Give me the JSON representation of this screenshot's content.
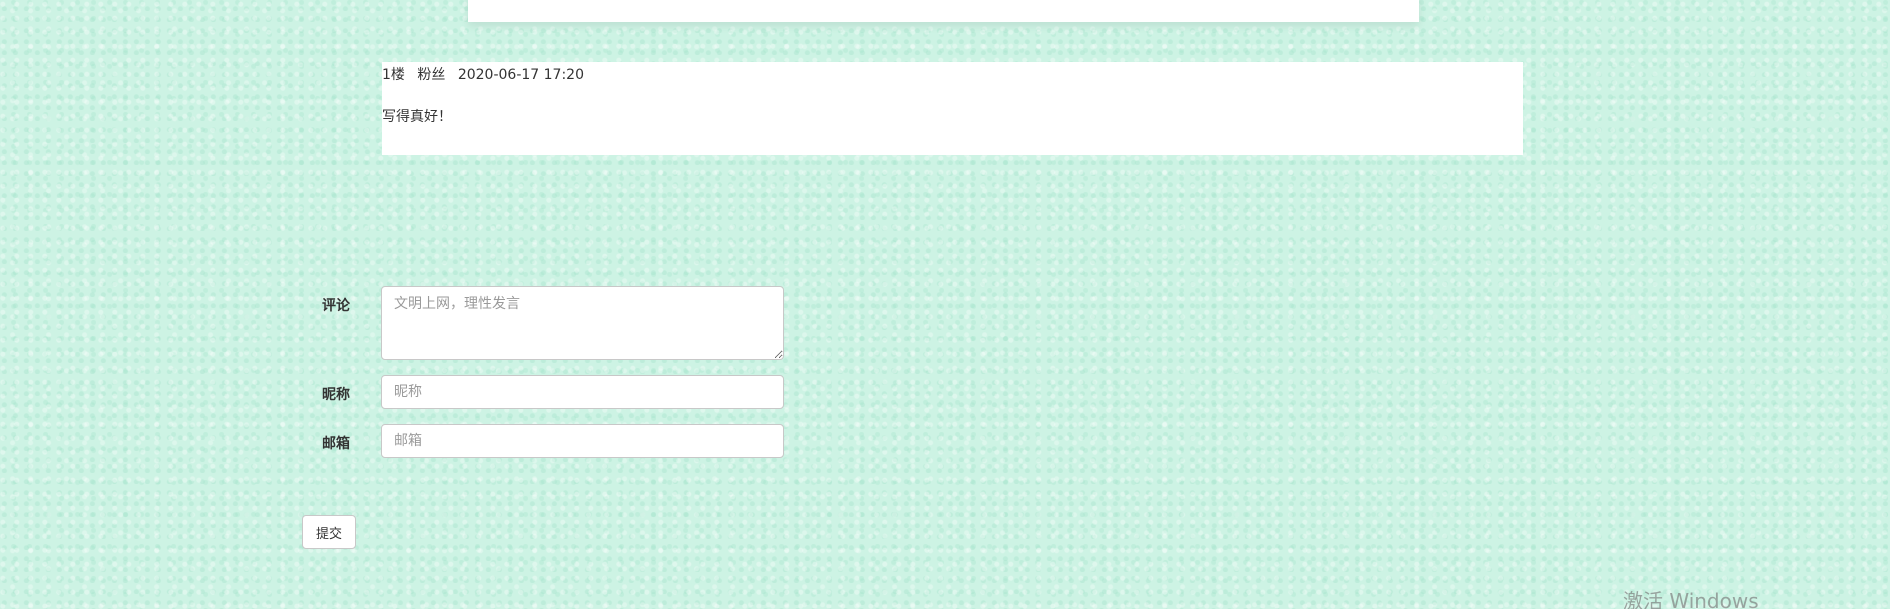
{
  "comment": {
    "floor": "1楼",
    "author": "粉丝",
    "time": "2020-06-17 17:20",
    "text": "写得真好！"
  },
  "form": {
    "comment_label": "评论",
    "comment_placeholder": "文明上网，理性发言",
    "nickname_label": "昵称",
    "nickname_placeholder": "昵称",
    "email_label": "邮箱",
    "email_placeholder": "邮箱",
    "submit_label": "提交"
  },
  "watermark": "激活 Windows",
  "colors": {
    "background": "#cdf3e4",
    "card": "#ffffff"
  }
}
